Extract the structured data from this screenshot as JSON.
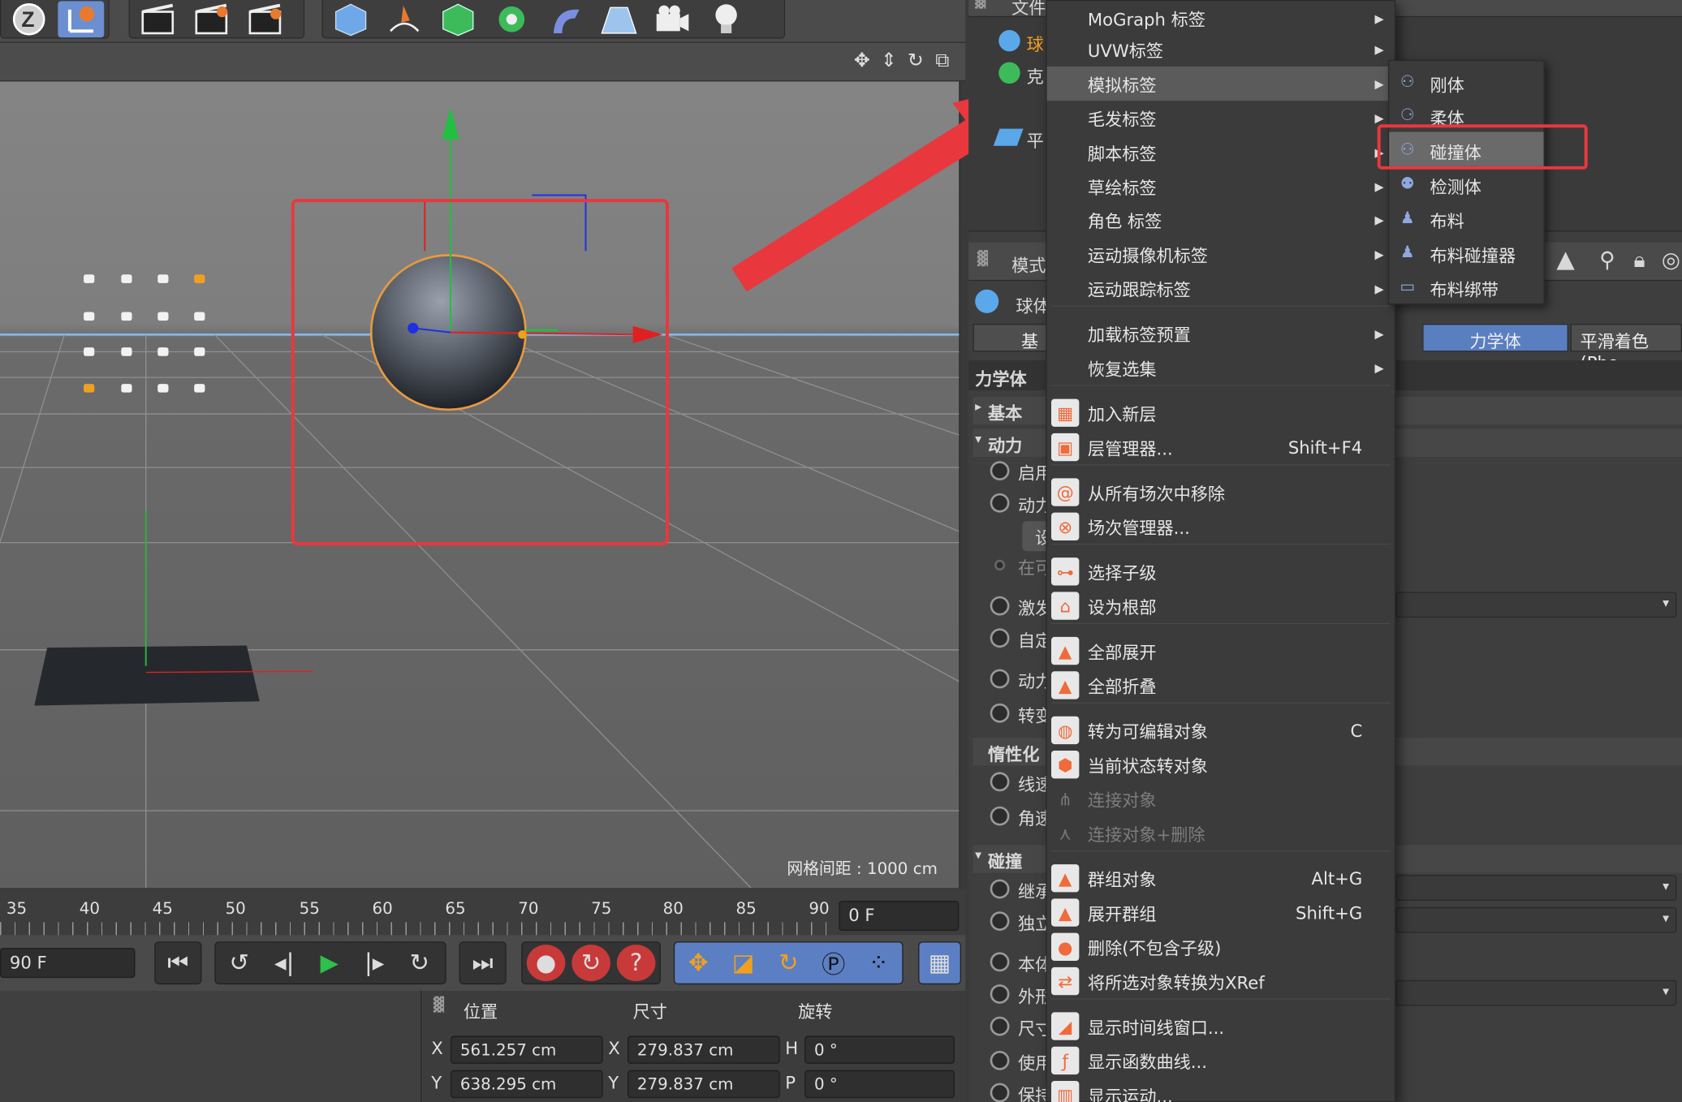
{
  "toolbar": {
    "icons": [
      "undo-z-icon",
      "coordinate-system-icon",
      "render-view-icon",
      "render-picture-viewer-icon",
      "edit-render-settings-icon",
      "cube-icon",
      "pen-spline-icon",
      "subdivision-icon",
      "mograph-cloner-icon",
      "deformer-icon",
      "floor-environment-icon",
      "camera-icon",
      "light-icon"
    ]
  },
  "viewport": {
    "grid_readout": "网格间距 : 1000 cm"
  },
  "timeline": {
    "ticks": [
      "35",
      "40",
      "45",
      "50",
      "55",
      "60",
      "65",
      "70",
      "75",
      "80",
      "85",
      "90"
    ],
    "current_frame": "0 F",
    "end_frame": "90 F"
  },
  "coordinates": {
    "headers": {
      "position": "位置",
      "size": "尺寸",
      "rotation": "旋转"
    },
    "rows": [
      {
        "axis": "X",
        "position": "561.257 cm",
        "size_axis": "X",
        "size": "279.837 cm",
        "rot_axis": "H",
        "rotation": "0 °"
      },
      {
        "axis": "Y",
        "position": "638.295 cm",
        "size_axis": "Y",
        "size": "279.837 cm",
        "rot_axis": "P",
        "rotation": "0 °"
      }
    ]
  },
  "right_panel": {
    "object_menu_title": "文件",
    "objects": [
      "球",
      "克",
      "平"
    ],
    "attr_menu_title": "模式",
    "attr_object": "球体",
    "tab_basic": "基",
    "tab_dynamics": "力学体",
    "tab_phong": "平滑着色(Pho",
    "section_title": "力学体",
    "groups": [
      "基本",
      "动力",
      "惰性化",
      "碰撞"
    ],
    "rows": [
      "启用",
      "动力",
      "设",
      "在可",
      "激发",
      "自定",
      "动力",
      "转变",
      "线速",
      "角速",
      "继承",
      "独立",
      "本体",
      "外形",
      "尺寸",
      "使用",
      "保持"
    ]
  },
  "context_menu": {
    "items": [
      {
        "label": "MoGraph 标签",
        "arrow": true
      },
      {
        "label": "UVW标签",
        "arrow": true
      },
      {
        "label": "模拟标签",
        "arrow": true,
        "highlight": true
      },
      {
        "label": "毛发标签",
        "arrow": true
      },
      {
        "label": "脚本标签",
        "arrow": true
      },
      {
        "label": "草绘标签",
        "arrow": true
      },
      {
        "label": "角色 标签",
        "arrow": true
      },
      {
        "label": "运动摄像机标签",
        "arrow": true
      },
      {
        "label": "运动跟踪标签",
        "arrow": true
      },
      {
        "label": "加载标签预置",
        "arrow": true
      },
      {
        "label": "恢复选集",
        "arrow": true
      },
      {
        "label": "加入新层",
        "icon": "add-layer-icon"
      },
      {
        "label": "层管理器...",
        "shortcut": "Shift+F4",
        "icon": "layer-manager-icon"
      },
      {
        "label": "从所有场次中移除",
        "icon": "remove-takes-icon"
      },
      {
        "label": "场次管理器...",
        "icon": "take-manager-icon"
      },
      {
        "label": "选择子级",
        "icon": "select-children-icon"
      },
      {
        "label": "设为根部",
        "icon": "set-root-icon"
      },
      {
        "label": "全部展开",
        "icon": "expand-all-icon"
      },
      {
        "label": "全部折叠",
        "icon": "collapse-all-icon"
      },
      {
        "label": "转为可编辑对象",
        "shortcut": "C",
        "icon": "make-editable-icon"
      },
      {
        "label": "当前状态转对象",
        "icon": "current-state-icon"
      },
      {
        "label": "连接对象",
        "disabled": true,
        "icon": "connect-objects-icon"
      },
      {
        "label": "连接对象+删除",
        "disabled": true,
        "icon": "connect-delete-icon"
      },
      {
        "label": "群组对象",
        "shortcut": "Alt+G",
        "icon": "group-objects-icon"
      },
      {
        "label": "展开群组",
        "shortcut": "Shift+G",
        "icon": "expand-group-icon"
      },
      {
        "label": "删除(不包含子级)",
        "icon": "delete-without-children-icon"
      },
      {
        "label": "将所选对象转换为XRef",
        "icon": "xref-icon"
      },
      {
        "label": "显示时间线窗口...",
        "icon": "timeline-window-icon"
      },
      {
        "label": "显示函数曲线...",
        "icon": "f-curve-icon"
      },
      {
        "label": "显示运动...",
        "icon": "motion-icon"
      }
    ]
  },
  "submenu": {
    "items": [
      {
        "label": "刚体",
        "icon": "rigid-body-icon"
      },
      {
        "label": "柔体",
        "icon": "soft-body-icon"
      },
      {
        "label": "碰撞体",
        "icon": "collider-body-icon",
        "highlight": true
      },
      {
        "label": "检测体",
        "icon": "ghost-body-icon"
      },
      {
        "label": "布料",
        "icon": "cloth-icon"
      },
      {
        "label": "布料碰撞器",
        "icon": "cloth-collider-icon"
      },
      {
        "label": "布料绑带",
        "icon": "cloth-belt-icon"
      }
    ]
  },
  "colors": {
    "annotation_red": "#e8383d",
    "axis_x": "#e02020",
    "axis_y": "#20c040",
    "axis_z": "#2030e0",
    "highlight": "#5b5b5b",
    "tab_active": "#5a7fc0"
  }
}
